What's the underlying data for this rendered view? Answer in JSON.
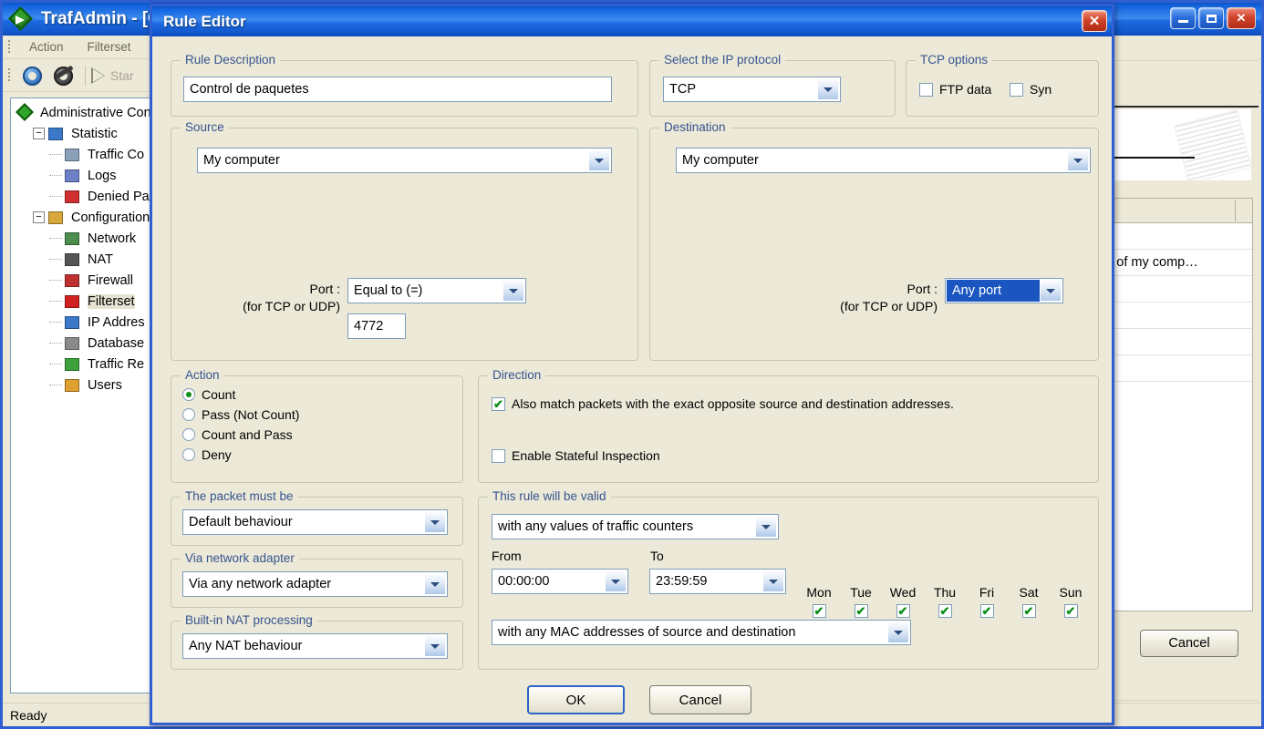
{
  "app": {
    "title": "TrafAdmin - [C",
    "icon": "green-diamond-arrow-icon",
    "menu": [
      "Action",
      "Filterset"
    ],
    "toolbar": {
      "settings_icon": "gear-icon",
      "tools_icon": "gear-wrench-icon",
      "start_label": "Star"
    },
    "window_buttons": {
      "minimize": "_",
      "maximize": "□",
      "close": "✕"
    },
    "status": "Ready",
    "tree": [
      {
        "label": "Administrative Con",
        "icon": "green-diamond-arrow-icon",
        "level": 0,
        "expander": ""
      },
      {
        "label": "Statistic",
        "icon": "bar-chart-icon",
        "level": 1,
        "expander": "−"
      },
      {
        "label": "Traffic Co",
        "icon": "counter-icon",
        "level": 2,
        "expander": ""
      },
      {
        "label": "Logs",
        "icon": "logs-icon",
        "level": 2,
        "expander": ""
      },
      {
        "label": "Denied Pa",
        "icon": "denied-packets-icon",
        "level": 2,
        "expander": ""
      },
      {
        "label": "Configuration",
        "icon": "wrench-icon",
        "level": 1,
        "expander": "−"
      },
      {
        "label": "Network",
        "icon": "network-icon",
        "level": 2,
        "expander": ""
      },
      {
        "label": "NAT",
        "icon": "nat-globe-icon",
        "level": 2,
        "expander": ""
      },
      {
        "label": "Firewall",
        "icon": "shield-icon",
        "level": 2,
        "expander": ""
      },
      {
        "label": "Filterset",
        "icon": "funnel-icon",
        "level": 2,
        "expander": "",
        "selected": true
      },
      {
        "label": "IP Addres",
        "icon": "checklist-icon",
        "level": 2,
        "expander": ""
      },
      {
        "label": "Database",
        "icon": "database-icon",
        "level": 2,
        "expander": ""
      },
      {
        "label": "Traffic Re",
        "icon": "document-export-icon",
        "level": 2,
        "expander": ""
      },
      {
        "label": "Users",
        "icon": "users-icon",
        "level": 2,
        "expander": ""
      }
    ],
    "right_panel": {
      "list_rows": [
        "",
        "c of my comp…",
        "",
        "",
        "",
        ""
      ],
      "cancel_label": "Cancel"
    }
  },
  "dialog": {
    "title": "Rule Editor",
    "close_glyph": "✕",
    "rule_description": {
      "legend": "Rule Description",
      "value": "Control de paquetes"
    },
    "ip_protocol": {
      "legend": "Select the IP protocol",
      "value": "TCP"
    },
    "tcp_options": {
      "legend": "TCP options",
      "ftp_data": {
        "label": "FTP data",
        "checked": false
      },
      "syn": {
        "label": "Syn",
        "checked": false
      }
    },
    "source": {
      "legend": "Source",
      "host": "My computer",
      "port_label_line1": "Port :",
      "port_label_line2": "(for TCP or UDP)",
      "port_mode": "Equal to (=)",
      "port_value": "4772"
    },
    "destination": {
      "legend": "Destination",
      "host": "My computer",
      "port_label_line1": "Port :",
      "port_label_line2": "(for TCP or UDP)",
      "port_mode": "Any port",
      "port_mode_focused": true
    },
    "action": {
      "legend": "Action",
      "options": [
        {
          "label": "Count",
          "selected": true
        },
        {
          "label": "Pass (Not Count)",
          "selected": false
        },
        {
          "label": "Count and Pass",
          "selected": false
        },
        {
          "label": "Deny",
          "selected": false
        }
      ]
    },
    "direction": {
      "legend": "Direction",
      "opposite": {
        "label": "Also match packets with the exact opposite source and destination addresses.",
        "checked": true
      },
      "stateful": {
        "label": "Enable Stateful Inspection",
        "checked": false
      }
    },
    "packet_must_be": {
      "legend": "The packet must be",
      "value": "Default behaviour"
    },
    "via_network_adapter": {
      "legend": "Via network adapter",
      "value": "Via any network adapter"
    },
    "nat_processing": {
      "legend": "Built-in NAT processing",
      "value": "Any NAT behaviour"
    },
    "validity": {
      "legend": "This rule will be valid",
      "counters": "with any values of traffic counters",
      "from_label": "From",
      "to_label": "To",
      "from_value": "00:00:00",
      "to_value": "23:59:59",
      "days": [
        {
          "label": "Mon",
          "checked": true
        },
        {
          "label": "Tue",
          "checked": true
        },
        {
          "label": "Wed",
          "checked": true
        },
        {
          "label": "Thu",
          "checked": true
        },
        {
          "label": "Fri",
          "checked": true
        },
        {
          "label": "Sat",
          "checked": true
        },
        {
          "label": "Sun",
          "checked": true
        }
      ],
      "mac": "with any MAC addresses of source and destination"
    },
    "buttons": {
      "ok": "OK",
      "cancel": "Cancel"
    },
    "checkmark": "✔",
    "colors": {
      "titlebar_blue": "#1467E3",
      "dialog_face": "#ECE9D8",
      "legend_blue": "#36548F",
      "check_green": "#0B8F17",
      "selection_blue": "#1B55C0",
      "close_red": "#D1452C"
    }
  }
}
